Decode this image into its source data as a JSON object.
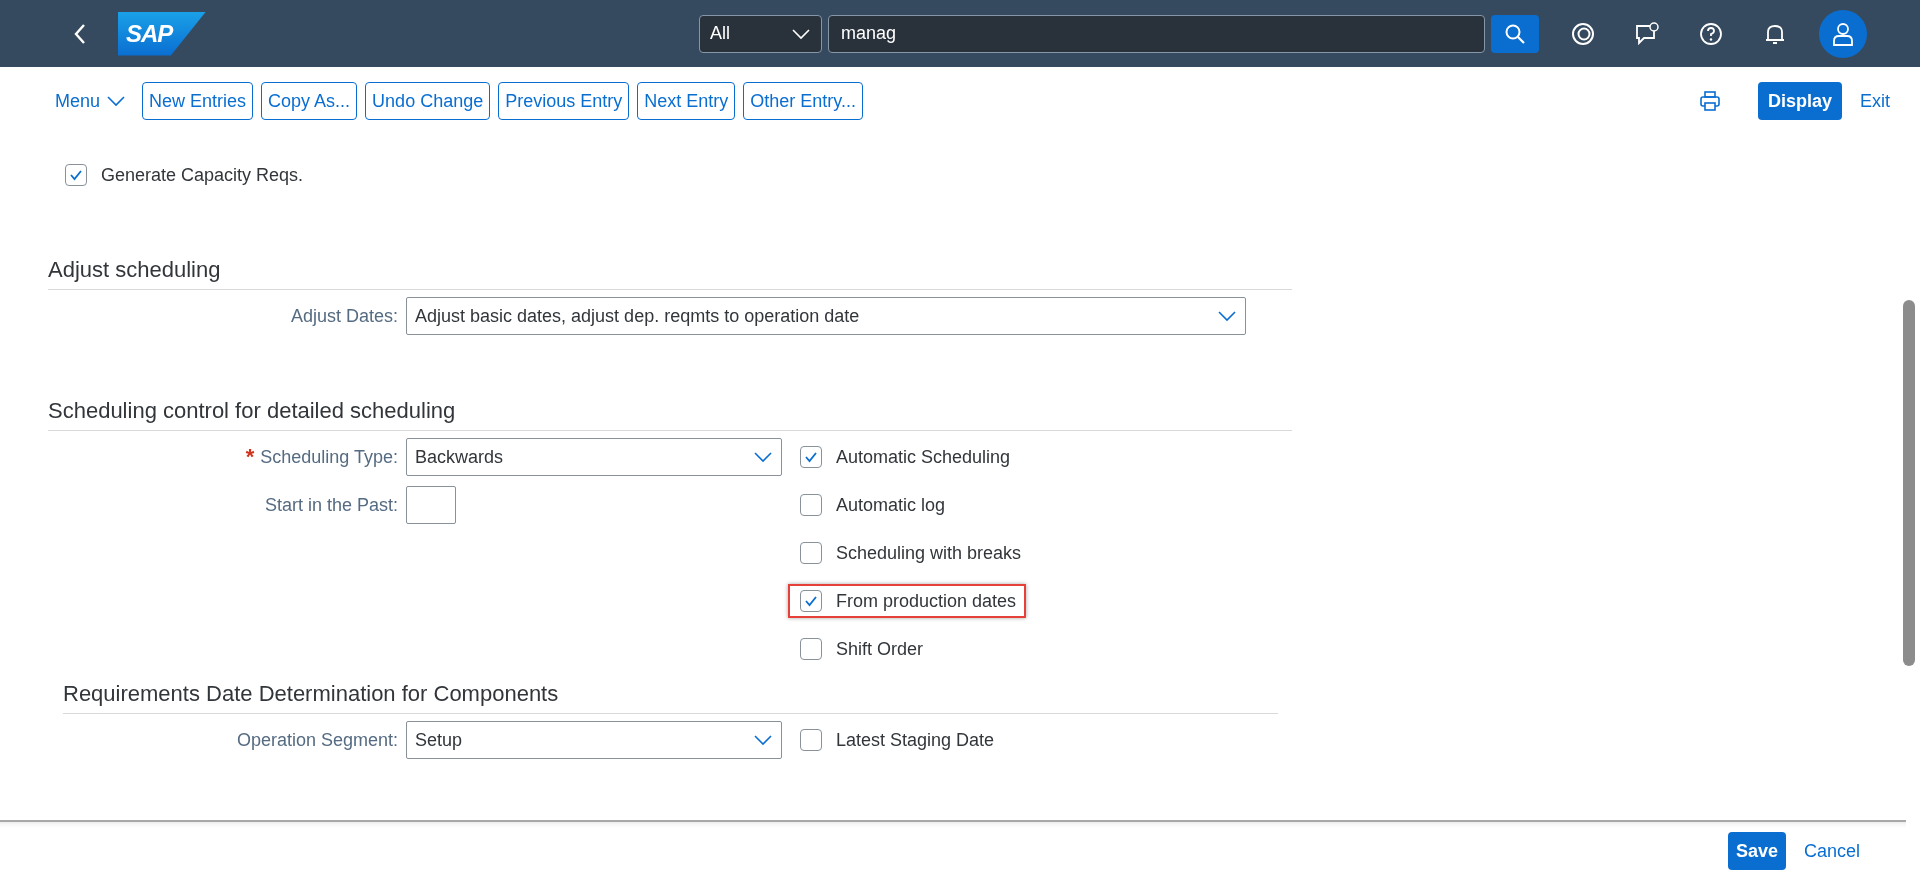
{
  "shell": {
    "logo": "SAP",
    "search_scope": "All",
    "search_value": "manag"
  },
  "toolbar": {
    "menu": "Menu",
    "buttons": [
      "New Entries",
      "Copy As...",
      "Undo Change",
      "Previous Entry",
      "Next Entry",
      "Other Entry..."
    ],
    "display": "Display",
    "exit": "Exit"
  },
  "top_checkbox": {
    "label": "Generate Capacity Reqs.",
    "checked": true
  },
  "sections": [
    {
      "kind": "group",
      "title": "Adjust scheduling",
      "rows": [
        {
          "field": {
            "label": "Adjust Dates:",
            "kind": "select",
            "value": "Adjust basic dates, adjust dep. reqmts to operation date"
          }
        }
      ]
    },
    {
      "kind": "group",
      "title": "Scheduling control for detailed scheduling",
      "rows": [
        {
          "field": {
            "label": "Scheduling Type:",
            "kind": "select",
            "value": "Backwards",
            "required_mark": "*"
          },
          "checkbox": {
            "label": "Automatic Scheduling",
            "checked": true
          }
        },
        {
          "field": {
            "label": "Start in the Past:",
            "kind": "input"
          },
          "checkbox": {
            "label": "Automatic log",
            "checked": false
          }
        },
        {
          "checkbox": {
            "label": "Scheduling with breaks",
            "checked": false
          }
        },
        {
          "checkbox": {
            "label": "From production dates",
            "checked": true,
            "highlighted": true
          }
        },
        {
          "checkbox": {
            "label": "Shift Order",
            "checked": false
          }
        }
      ]
    },
    {
      "kind": "subgroup",
      "title": "Requirements Date Determination for Components",
      "rows": [
        {
          "field": {
            "label": "Operation Segment:",
            "kind": "select",
            "value": "Setup"
          },
          "checkbox": {
            "label": "Latest Staging Date",
            "checked": false
          }
        }
      ]
    }
  ],
  "footer": {
    "save": "Save",
    "cancel": "Cancel"
  }
}
